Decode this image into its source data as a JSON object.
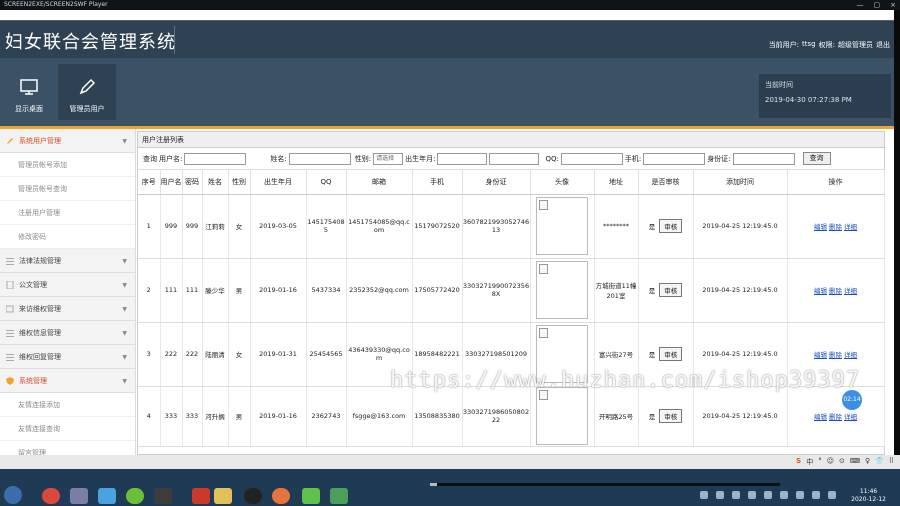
{
  "player": {
    "title": "SCREEN2EXE/SCREEN2SWF Player",
    "controls": [
      "—",
      "▢",
      "×"
    ]
  },
  "header": {
    "title": "妇女联合会管理系统",
    "user_label": "当前用户:",
    "user": "ttsg",
    "role_label": "权限:",
    "role": "超级管理员",
    "logout": "退出"
  },
  "toolbar": {
    "items": [
      {
        "label": "显示桌面",
        "icon": "monitor-icon"
      },
      {
        "label": "管理员用户",
        "icon": "pen-icon"
      }
    ],
    "time_label": "当前时间",
    "time": "2019-04-30 07:27:38 PM"
  },
  "sidebar": {
    "groups": [
      {
        "label": "系统用户管理",
        "expanded": true,
        "items": [
          "管理员帐号添加",
          "管理员帐号查询",
          "注册用户管理",
          "修改密码"
        ]
      },
      {
        "label": "法律法规管理",
        "expanded": false,
        "items": []
      },
      {
        "label": "公文管理",
        "expanded": false,
        "items": []
      },
      {
        "label": "来访维权管理",
        "expanded": false,
        "items": []
      },
      {
        "label": "维权信息管理",
        "expanded": false,
        "items": []
      },
      {
        "label": "维权回复管理",
        "expanded": false,
        "items": []
      },
      {
        "label": "系统管理",
        "expanded": true,
        "items": [
          "友情连接添加",
          "友情连接查询",
          "留言管理"
        ]
      }
    ]
  },
  "main": {
    "panel_title": "用户注册列表",
    "search": {
      "label": "查询",
      "f1": "用户名:",
      "f2": "姓名:",
      "f3": "性别:",
      "gender_value": "请选择",
      "f4": "出生年月:",
      "f5": "QQ:",
      "f6": "手机:",
      "f7": "身份证:",
      "button": "查询"
    },
    "columns": [
      "序号",
      "用户名",
      "密码",
      "姓名",
      "性别",
      "出生年月",
      "QQ",
      "邮箱",
      "手机",
      "身份证",
      "头像",
      "地址",
      "是否审核",
      "添加时间",
      "操作"
    ],
    "rows": [
      {
        "no": "1",
        "username": "999",
        "password": "999",
        "name": "江莉莉",
        "gender": "女",
        "birth": "2019-03-05",
        "qq": "1451754085",
        "email": "1451754085@qq.com",
        "phone": "15179072520",
        "idcard": "360782199305274613",
        "address": "********",
        "approved": "是",
        "added": "2019-04-25 12:19:45.0"
      },
      {
        "no": "2",
        "username": "111",
        "password": "111",
        "name": "滕少华",
        "gender": "男",
        "birth": "2019-01-16",
        "qq": "5437334",
        "email": "2352352@qq.com",
        "phone": "17505772420",
        "idcard": "33032719900723568X",
        "address": "方城街道11幢201室",
        "approved": "是",
        "added": "2019-04-25 12:19:45.0"
      },
      {
        "no": "3",
        "username": "222",
        "password": "222",
        "name": "陆丽清",
        "gender": "女",
        "birth": "2019-01-31",
        "qq": "25454565",
        "email": "436439330@qq.com",
        "phone": "18958482221",
        "idcard": "330327198501209",
        "address": "富兴街27号",
        "approved": "是",
        "added": "2019-04-25 12:19:45.0"
      },
      {
        "no": "4",
        "username": "333",
        "password": "333",
        "name": "河升搁",
        "gender": "男",
        "birth": "2019-01-16",
        "qq": "2362743",
        "email": "fsgge@163.com",
        "phone": "13508835380",
        "idcard": "330327198605080222",
        "address": "开明路25号",
        "approved": "是",
        "added": "2019-04-25 12:19:45.0"
      }
    ],
    "audit_button": "审核",
    "ops": [
      "编辑",
      "删除",
      "详细"
    ]
  },
  "overlay": {
    "watermark": "https://www.huzhan.com/ishop39397",
    "timer": "02:14"
  },
  "ime": {
    "brand": "S",
    "items": [
      "中",
      "°",
      "☺",
      "⊙",
      "⌨",
      "♀",
      "👕",
      "⠿"
    ]
  },
  "taskbar": {
    "time": "11:46",
    "date": "2020-12-12",
    "progress": 0.02
  }
}
